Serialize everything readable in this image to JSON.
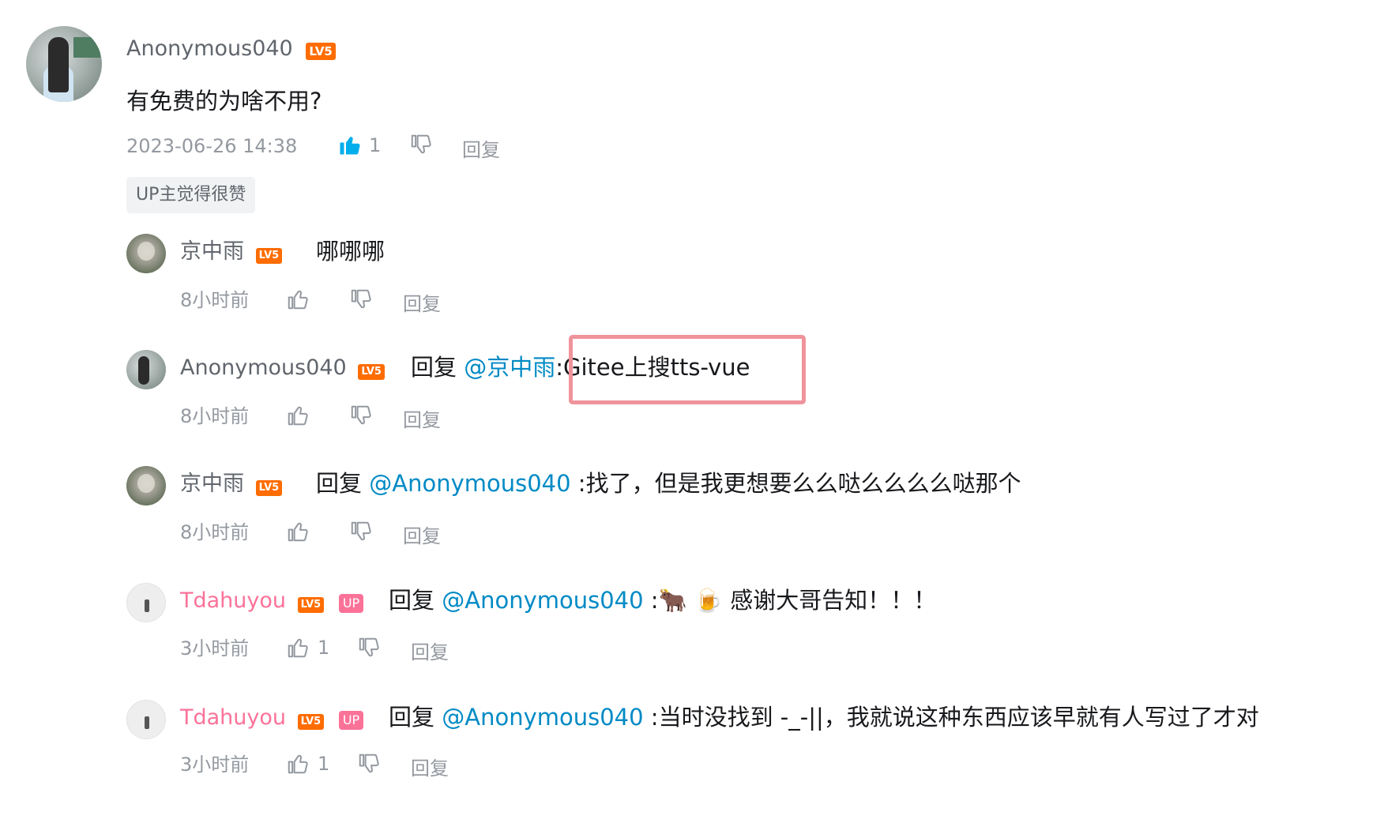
{
  "root_comment": {
    "username": "Anonymous040",
    "level": "LV5",
    "text": "有免费的为啥不用?",
    "time": "2023-06-26 14:38",
    "likes": "1",
    "reply_label": "回复",
    "tag": "UP主觉得很赞"
  },
  "replies": [
    {
      "username": "京中雨",
      "level": "LV5",
      "reply_word": "",
      "mention": "",
      "text": "哪哪哪",
      "time": "8小时前",
      "likes": "",
      "reply_label": "回复"
    },
    {
      "username": "Anonymous040",
      "level": "LV5",
      "reply_word": "回复",
      "mention": "@京中雨",
      "text": ":Gitee上搜tts-vue",
      "time": "8小时前",
      "likes": "",
      "reply_label": "回复"
    },
    {
      "username": "京中雨",
      "level": "LV5",
      "reply_word": "回复",
      "mention": "@Anonymous040",
      "text": ":找了，但是我更想要么么哒么么么么哒那个",
      "time": "8小时前",
      "likes": "",
      "reply_label": "回复"
    },
    {
      "username": "Tdahuyou",
      "level": "LV5",
      "up": "UP",
      "reply_word": "回复",
      "mention": "@Anonymous040",
      "text": ":🐂 🍺 感谢大哥告知！！！",
      "time": "3小时前",
      "likes": "1",
      "reply_label": "回复"
    },
    {
      "username": "Tdahuyou",
      "level": "LV5",
      "up": "UP",
      "reply_word": "回复",
      "mention": "@Anonymous040",
      "text": ":当时没找到 -_-||，我就说这种东西应该早就有人写过了才对",
      "time": "3小时前",
      "likes": "1",
      "reply_label": "回复"
    }
  ],
  "colors": {
    "mention": "#008ac5",
    "up_name": "#fb7299",
    "level": "#ff6c00",
    "highlight": "#f0939b",
    "like_active": "#00aeec"
  }
}
